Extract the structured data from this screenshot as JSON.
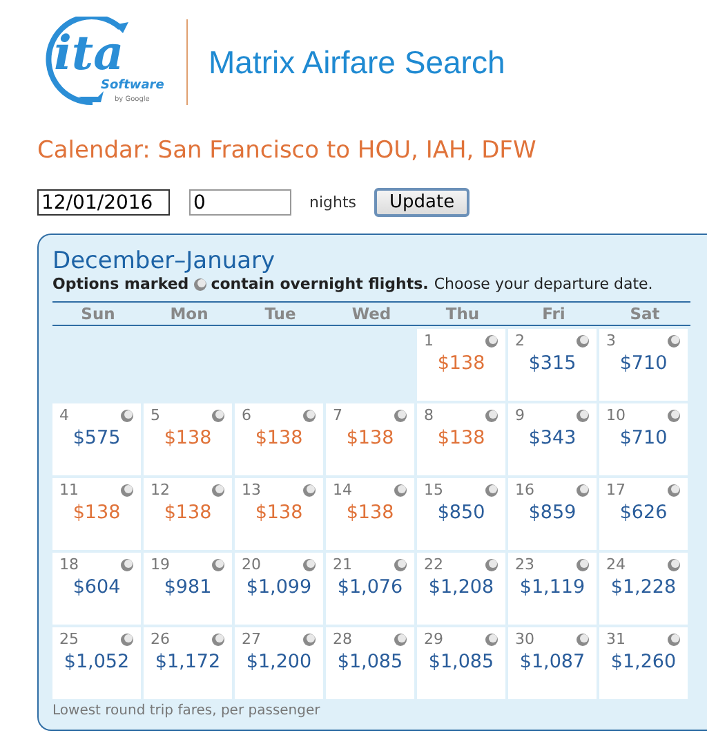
{
  "logo": {
    "mark": "ita",
    "product": "Software",
    "byline": "by Google"
  },
  "app_title": "Matrix Airfare Search",
  "heading": "Calendar: San Francisco to HOU, IAH, DFW",
  "form": {
    "date": "12/01/2016",
    "nights": "0",
    "nights_label": "nights",
    "button": "Update"
  },
  "calendar": {
    "title": "December–January",
    "note": {
      "bold_before": "Options marked",
      "bold_after": "contain overnight flights.",
      "rest": "Choose your departure date."
    },
    "weekdays": [
      "Sun",
      "Mon",
      "Tue",
      "Wed",
      "Thu",
      "Fri",
      "Sat"
    ],
    "days": [
      {
        "kind": "blank"
      },
      {
        "kind": "blank"
      },
      {
        "kind": "blank"
      },
      {
        "kind": "blank"
      },
      {
        "day": "1",
        "price": "$138",
        "lowest": true,
        "overnight": true
      },
      {
        "day": "2",
        "price": "$315",
        "lowest": false,
        "overnight": true
      },
      {
        "day": "3",
        "price": "$710",
        "lowest": false,
        "overnight": true
      },
      {
        "day": "4",
        "price": "$575",
        "lowest": false,
        "overnight": true
      },
      {
        "day": "5",
        "price": "$138",
        "lowest": true,
        "overnight": true
      },
      {
        "day": "6",
        "price": "$138",
        "lowest": true,
        "overnight": true
      },
      {
        "day": "7",
        "price": "$138",
        "lowest": true,
        "overnight": true
      },
      {
        "day": "8",
        "price": "$138",
        "lowest": true,
        "overnight": true
      },
      {
        "day": "9",
        "price": "$343",
        "lowest": false,
        "overnight": true
      },
      {
        "day": "10",
        "price": "$710",
        "lowest": false,
        "overnight": true
      },
      {
        "day": "11",
        "price": "$138",
        "lowest": true,
        "overnight": true
      },
      {
        "day": "12",
        "price": "$138",
        "lowest": true,
        "overnight": true
      },
      {
        "day": "13",
        "price": "$138",
        "lowest": true,
        "overnight": true
      },
      {
        "day": "14",
        "price": "$138",
        "lowest": true,
        "overnight": true
      },
      {
        "day": "15",
        "price": "$850",
        "lowest": false,
        "overnight": true
      },
      {
        "day": "16",
        "price": "$859",
        "lowest": false,
        "overnight": true
      },
      {
        "day": "17",
        "price": "$626",
        "lowest": false,
        "overnight": true
      },
      {
        "day": "18",
        "price": "$604",
        "lowest": false,
        "overnight": true
      },
      {
        "day": "19",
        "price": "$981",
        "lowest": false,
        "overnight": true
      },
      {
        "day": "20",
        "price": "$1,099",
        "lowest": false,
        "overnight": true
      },
      {
        "day": "21",
        "price": "$1,076",
        "lowest": false,
        "overnight": true
      },
      {
        "day": "22",
        "price": "$1,208",
        "lowest": false,
        "overnight": true
      },
      {
        "day": "23",
        "price": "$1,119",
        "lowest": false,
        "overnight": true
      },
      {
        "day": "24",
        "price": "$1,228",
        "lowest": false,
        "overnight": true
      },
      {
        "day": "25",
        "price": "$1,052",
        "lowest": false,
        "overnight": true
      },
      {
        "day": "26",
        "price": "$1,172",
        "lowest": false,
        "overnight": true
      },
      {
        "day": "27",
        "price": "$1,200",
        "lowest": false,
        "overnight": true
      },
      {
        "day": "28",
        "price": "$1,085",
        "lowest": false,
        "overnight": true
      },
      {
        "day": "29",
        "price": "$1,085",
        "lowest": false,
        "overnight": true
      },
      {
        "day": "30",
        "price": "$1,087",
        "lowest": false,
        "overnight": true
      },
      {
        "day": "31",
        "price": "$1,260",
        "lowest": false,
        "overnight": true
      }
    ],
    "footnote": "Lowest round trip fares, per passenger"
  }
}
